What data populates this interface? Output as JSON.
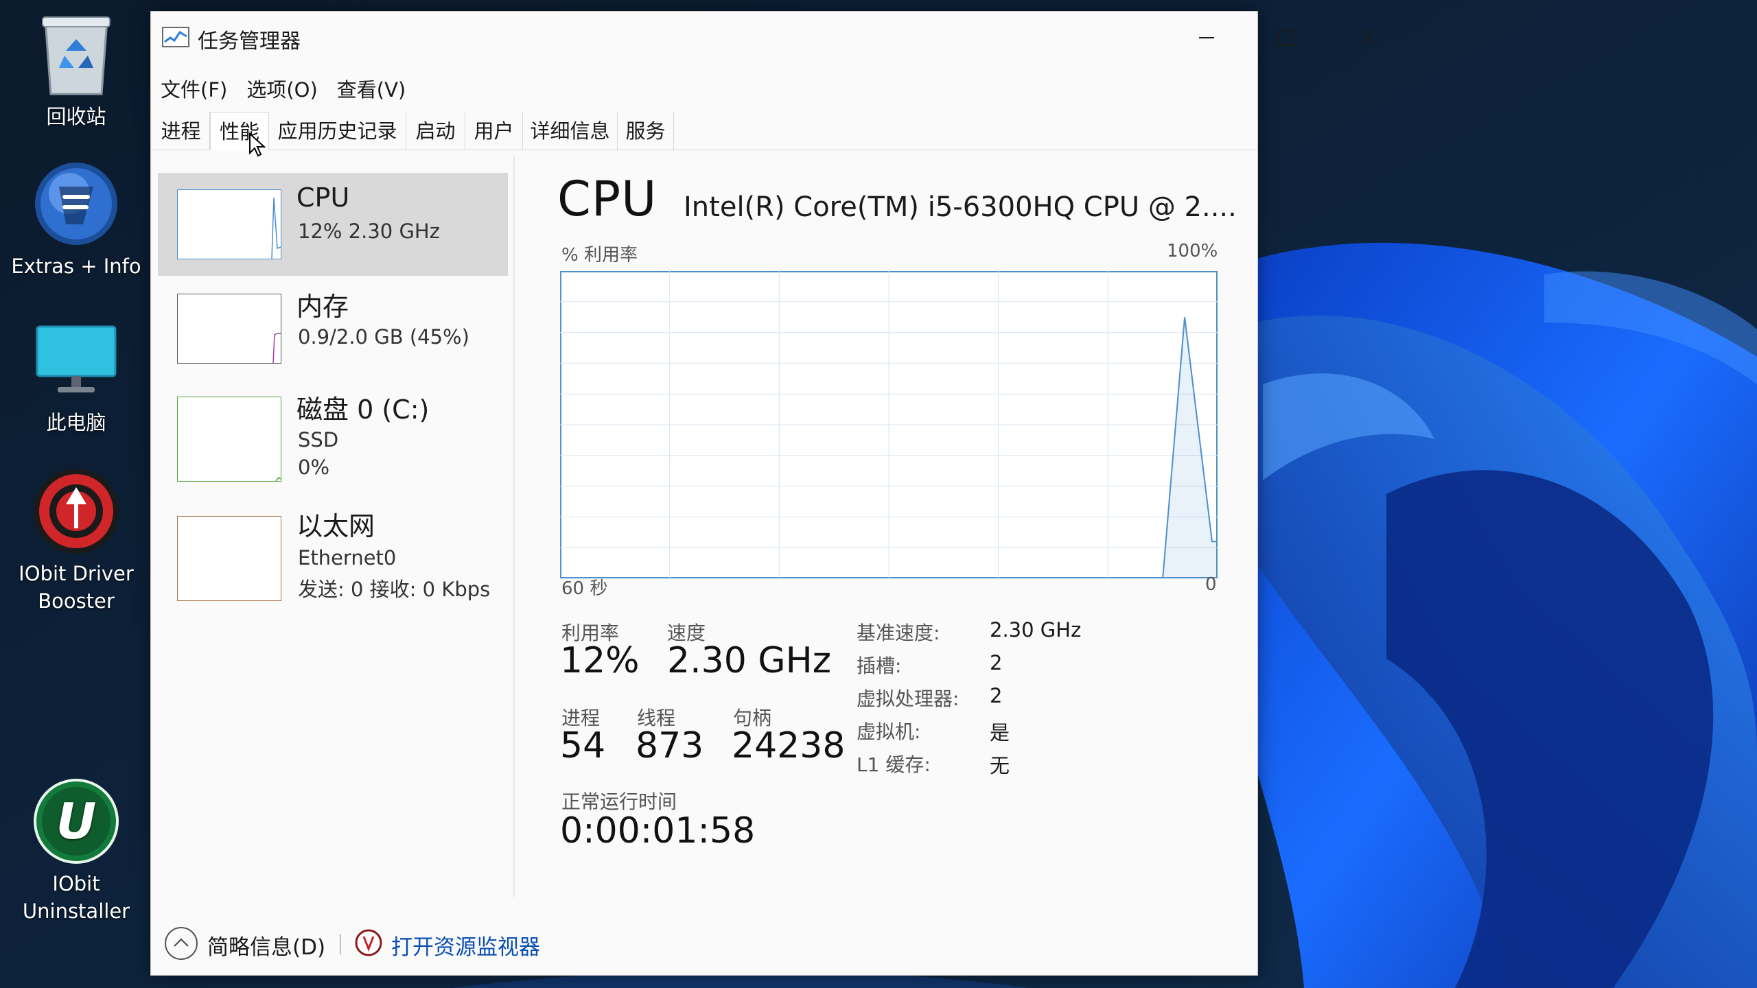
{
  "desktop": {
    "icons": [
      {
        "label": "回收站"
      },
      {
        "label": "Extras + Info"
      },
      {
        "label": "此电脑"
      },
      {
        "label": "IObit Driver Booster"
      },
      {
        "label": "IObit Uninstaller"
      }
    ]
  },
  "window": {
    "title": "任务管理器",
    "menu": [
      "文件(F)",
      "选项(O)",
      "查看(V)"
    ],
    "tabs": [
      "进程",
      "性能",
      "应用历史记录",
      "启动",
      "用户",
      "详细信息",
      "服务"
    ],
    "active_tab": "性能"
  },
  "resources": [
    {
      "name": "CPU",
      "line1": "12%  2.30 GHz",
      "line2": "",
      "selected": true,
      "spark_color": "#4d8fcf"
    },
    {
      "name": "内存",
      "line1": "0.9/2.0 GB (45%)",
      "line2": "",
      "selected": false,
      "spark_color": "#a53ea2"
    },
    {
      "name": "磁盘 0 (C:)",
      "line1": "SSD",
      "line2": "0%",
      "selected": false,
      "spark_color": "#4fa83a"
    },
    {
      "name": "以太网",
      "line1": "Ethernet0",
      "line2": "发送: 0 接收: 0 Kbps",
      "selected": false,
      "spark_color": "#a7744a"
    }
  ],
  "detail": {
    "title": "CPU",
    "model": "Intel(R) Core(TM) i5-6300HQ CPU @ 2....",
    "y_label": "% 利用率",
    "y_max_label": "100%",
    "x_left_label": "60 秒",
    "x_right_label": "0",
    "graph_color": "#4d8fcf",
    "stats": {
      "utilization_label": "利用率",
      "utilization": "12%",
      "speed_label": "速度",
      "speed": "2.30 GHz",
      "processes_label": "进程",
      "processes": "54",
      "threads_label": "线程",
      "threads": "873",
      "handles_label": "句柄",
      "handles": "24238",
      "uptime_label": "正常运行时间",
      "uptime": "0:00:01:58"
    },
    "specs": [
      {
        "key": "基准速度:",
        "value": "2.30 GHz"
      },
      {
        "key": "插槽:",
        "value": "2"
      },
      {
        "key": "虚拟处理器:",
        "value": "2"
      },
      {
        "key": "虚拟机:",
        "value": "是"
      },
      {
        "key": "L1 缓存:",
        "value": "无"
      }
    ]
  },
  "chart_data": {
    "type": "line",
    "xlabel": "60 秒",
    "ylabel": "% 利用率",
    "xlim": [
      60,
      0
    ],
    "ylim": [
      0,
      100
    ],
    "x": [
      60,
      5,
      3,
      0.5,
      0
    ],
    "series": [
      {
        "values": [
          0,
          0,
          85,
          12,
          12
        ]
      }
    ]
  },
  "footer": {
    "fewer_details": "简略信息(D)",
    "open_monitor": "打开资源监视器"
  }
}
